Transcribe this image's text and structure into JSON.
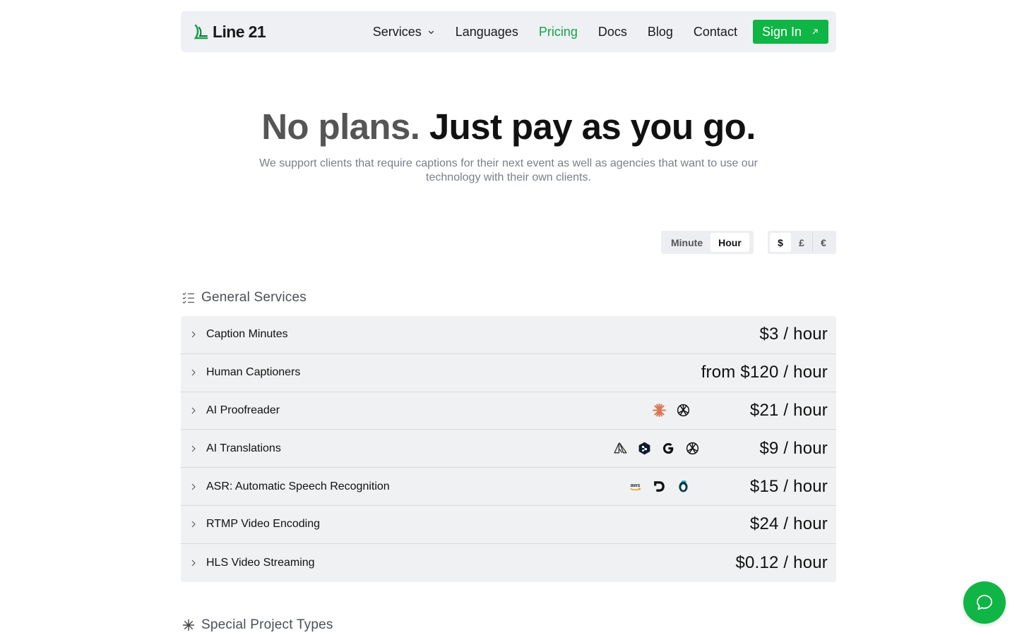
{
  "brand": {
    "name": "Line 21",
    "accent": "#0fb545"
  },
  "nav": {
    "links": [
      {
        "label": "Services",
        "has_dropdown": true,
        "icon": "chevron-down-icon"
      },
      {
        "label": "Languages"
      },
      {
        "label": "Pricing",
        "active": true
      },
      {
        "label": "Docs"
      },
      {
        "label": "Blog"
      },
      {
        "label": "Contact"
      }
    ],
    "signin_label": "Sign In",
    "signin_icon": "arrow-up-right-icon"
  },
  "hero": {
    "title_muted": "No plans.",
    "title_strong": "Just pay as you go.",
    "subtitle": "We support clients that require captions for their next event as well as agencies that want to use our technology with their own clients."
  },
  "toggles": {
    "unit": {
      "options": [
        "Minute",
        "Hour"
      ],
      "selected": "Hour"
    },
    "currency": {
      "options": [
        "$",
        "£",
        "€"
      ],
      "selected": "$"
    }
  },
  "general_services": {
    "title": "General Services",
    "icon": "checklist-icon",
    "rows": [
      {
        "label": "Caption Minutes",
        "price": "$3 / hour",
        "icons": []
      },
      {
        "label": "Human Captioners",
        "price": "from $120 / hour",
        "icons": []
      },
      {
        "label": "AI Proofreader",
        "price": "$21 / hour",
        "icons": [
          "anthropic-icon",
          "openai-icon"
        ]
      },
      {
        "label": "AI Translations",
        "price": "$9 / hour",
        "icons": [
          "azure-icon",
          "deepl-icon",
          "google-icon",
          "openai-icon"
        ]
      },
      {
        "label": "ASR: Automatic Speech Recognition",
        "price": "$15 / hour",
        "icons": [
          "aws-icon",
          "deepgram-icon",
          "speechmatics-icon"
        ]
      },
      {
        "label": "RTMP Video Encoding",
        "price": "$24 / hour",
        "icons": []
      },
      {
        "label": "HLS Video Streaming",
        "price": "$0.12 / hour",
        "icons": []
      }
    ]
  },
  "special_projects": {
    "title": "Special Project Types",
    "icon": "asterisk-icon"
  },
  "chat": {
    "icon": "chat-bubble-icon"
  }
}
